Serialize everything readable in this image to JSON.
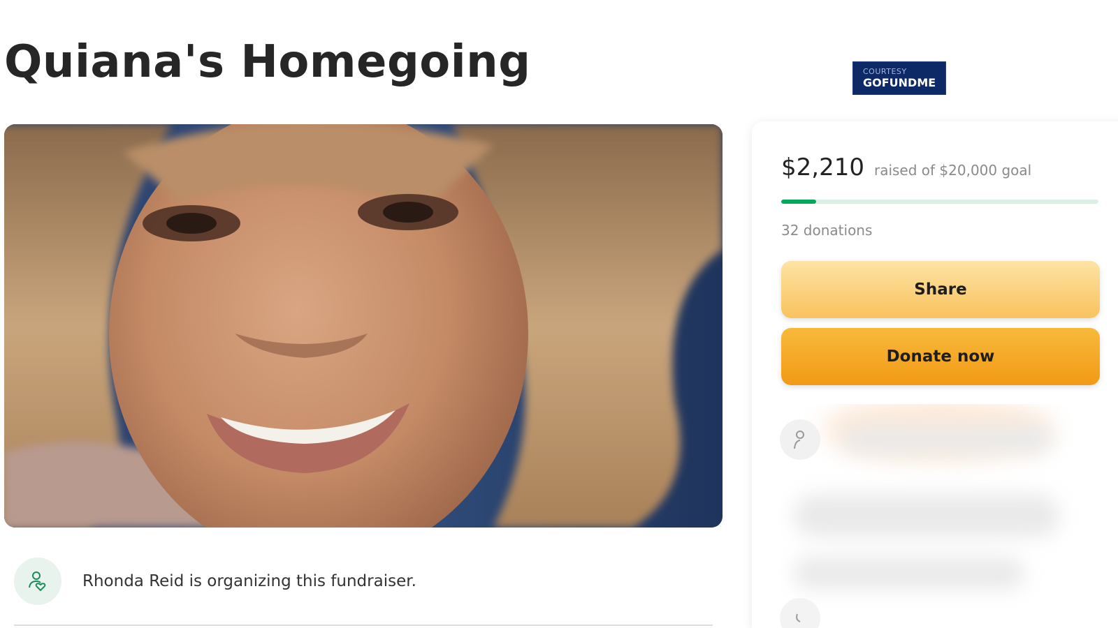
{
  "campaign": {
    "title": "Quiana's Homegoing"
  },
  "watermark": {
    "line1": "COURTESY",
    "line2": "GOFUNDME"
  },
  "organizer": {
    "text": "Rhonda Reid is organizing this fundraiser.",
    "icon": "person-heart-icon"
  },
  "donation_card": {
    "amount": "$2,210",
    "goal_text": "raised of $20,000 goal",
    "progress_fraction": 0.11,
    "donations_text": "32 donations",
    "share_label": "Share",
    "donate_label": "Donate now"
  },
  "colors": {
    "progress": "#02a95c",
    "progress_track": "#dcefe5",
    "share_button": "#f9c25e",
    "donate_button": "#f29a16",
    "watermark_bg": "#0e2a66"
  }
}
